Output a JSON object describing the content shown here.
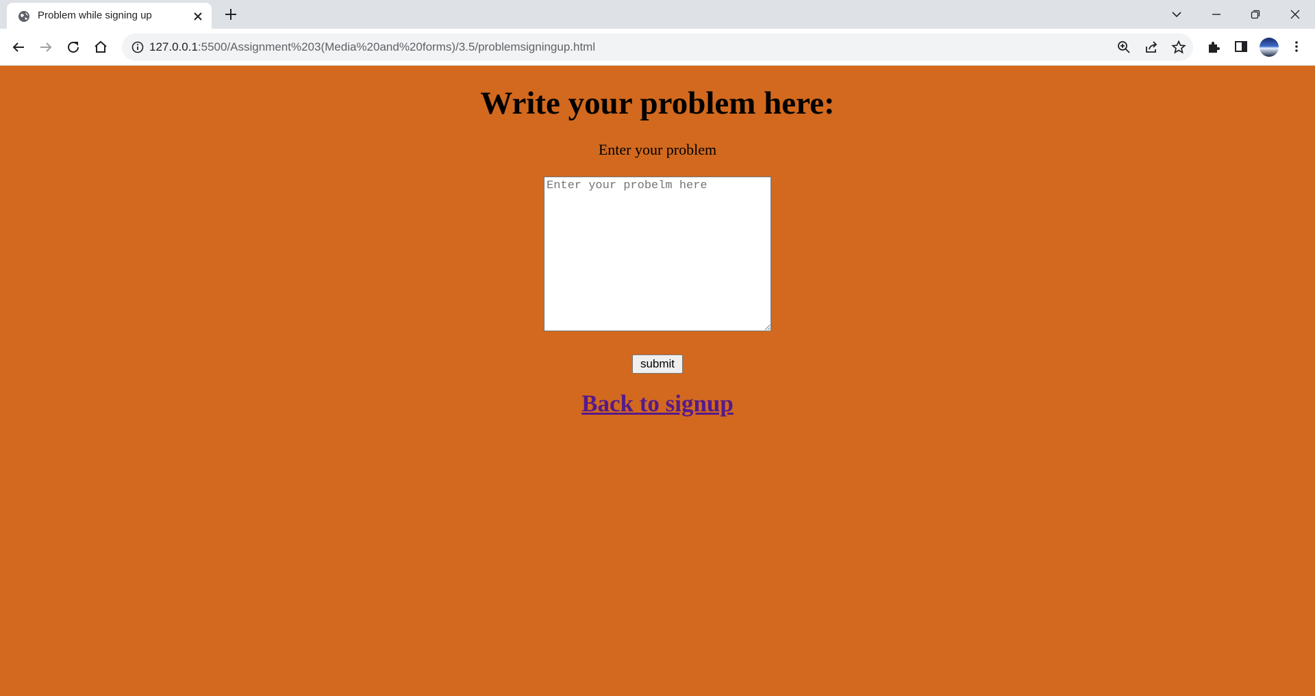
{
  "browser": {
    "tab_title": "Problem while signing up",
    "url_host": "127.0.0.1",
    "url_rest": ":5500/Assignment%203(Media%20and%20forms)/3.5/problemsigningup.html"
  },
  "page": {
    "heading": "Write your problem here:",
    "label": "Enter your problem",
    "textarea_placeholder": "Enter your probelm here",
    "submit_label": "submit",
    "back_link": "Back to signup"
  },
  "colors": {
    "page_background": "#d2691e",
    "link": "#551a8b"
  }
}
